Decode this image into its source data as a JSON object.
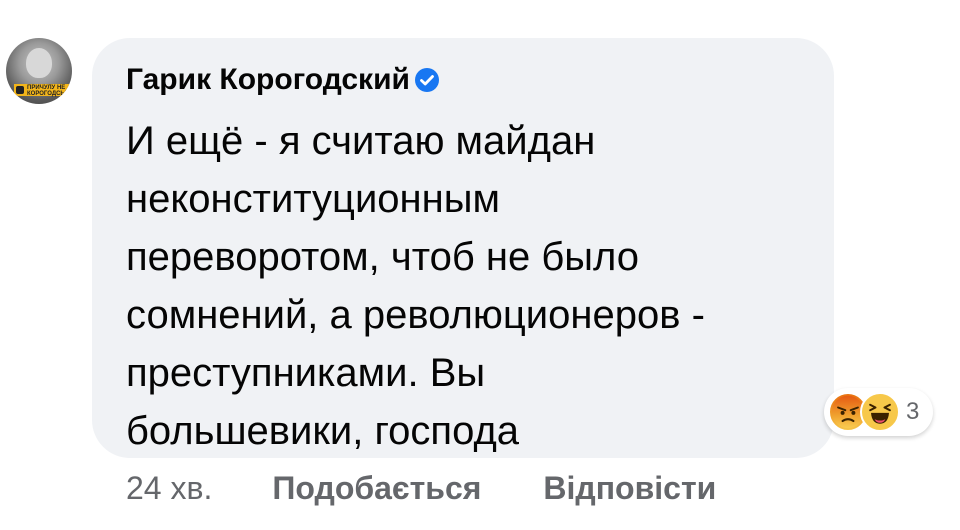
{
  "comment": {
    "author": "Гарик Корогодский",
    "verified_icon": "verified-badge-icon",
    "text": "И ещё - я считаю майдан\nнеконституционным\nпереворотом, чтоб не было\nсомнений, а революционеров -\nпреступниками. Вы\nбольшевики, господа",
    "avatar_badge_text": "ПРИЧУЛУ НЕ\nКОРОГОДСЬКИЙ"
  },
  "reactions": {
    "icons": [
      "angry-reaction-icon",
      "haha-reaction-icon"
    ],
    "count": "3"
  },
  "footer": {
    "time": "24 хв.",
    "like_label": "Подобається",
    "reply_label": "Відповісти"
  },
  "colors": {
    "bubble": "#f0f2f5",
    "meta_text": "#65676b",
    "verified": "#1877f2",
    "angry": "#e9710f",
    "haha": "#f7c84a"
  }
}
